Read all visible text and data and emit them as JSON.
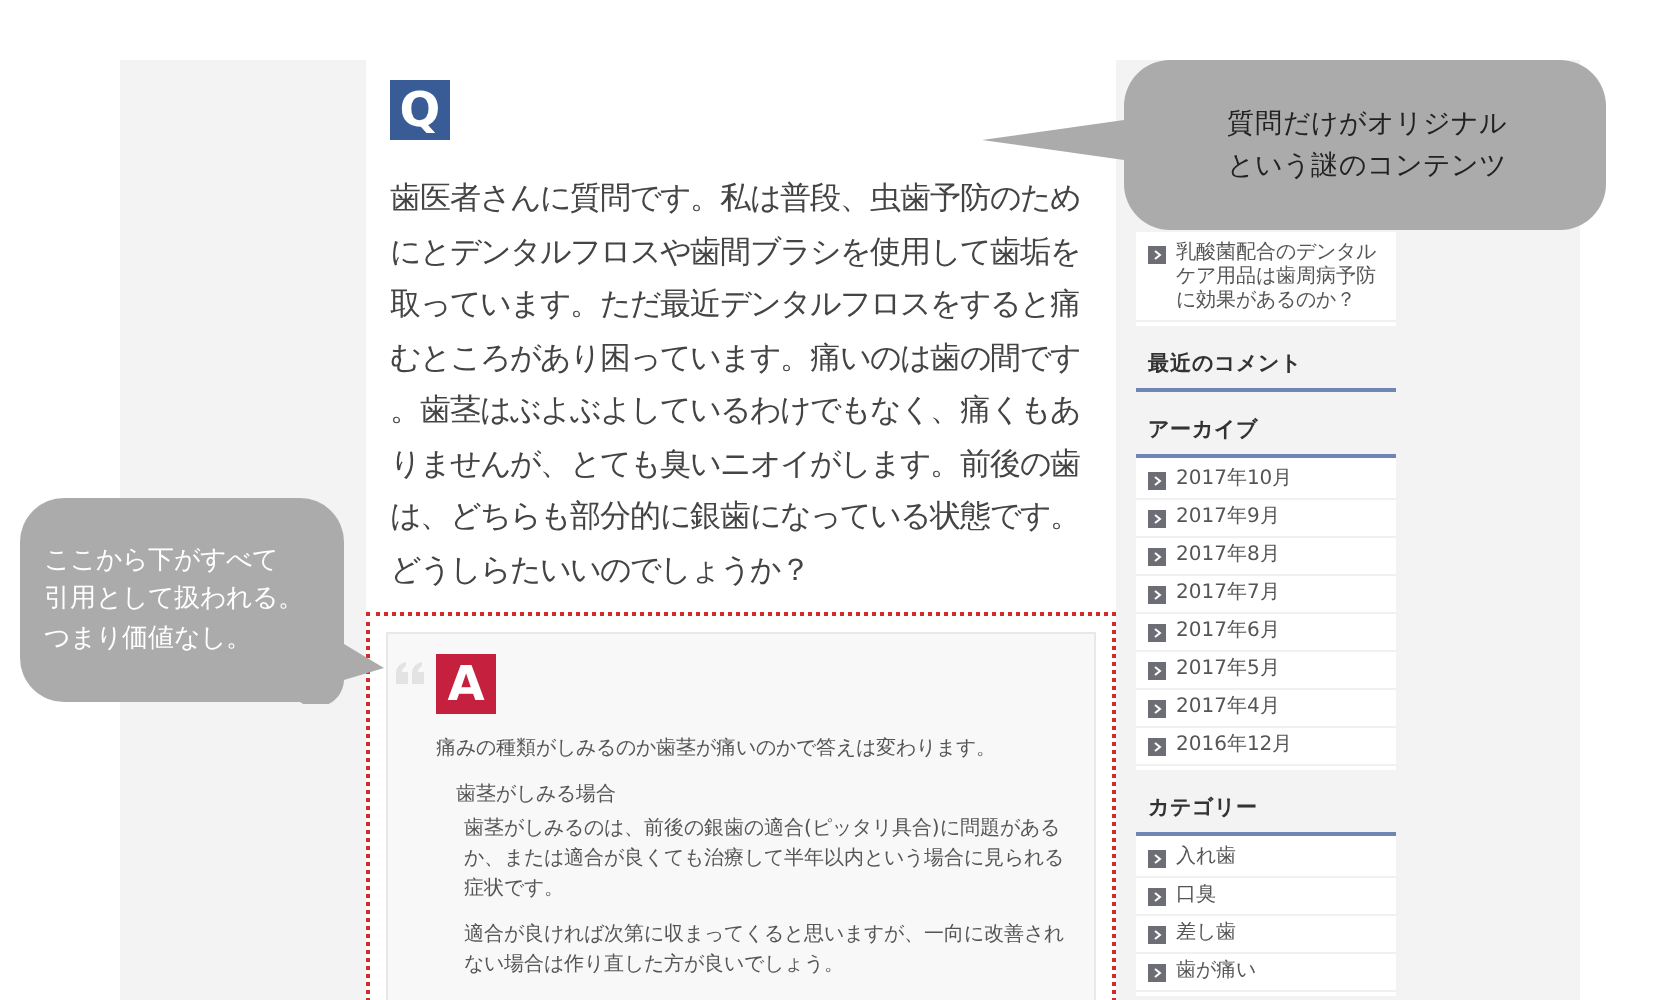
{
  "question": {
    "badge": "Q",
    "text": "歯医者さんに質問です。私は普段、虫歯予防のためにとデンタルフロスや歯間ブラシを使用して歯垢を取っています。ただ最近デンタルフロスをすると痛むところがあり困っています。痛いのは歯の間です。歯茎はぶよぶよしているわけでもなく、痛くもありませんが、とても臭いニオイがします。前後の歯は、どちらも部分的に銀歯になっている状態です。どうしらたいいのでしょうか？"
  },
  "answer": {
    "badge": "A",
    "paragraphs": [
      {
        "kind": "lead",
        "text": "痛みの種類がしみるのか歯茎が痛いのかで答えは変わります。"
      },
      {
        "kind": "heading",
        "text": "歯茎がしみる場合"
      },
      {
        "kind": "body",
        "text": "歯茎がしみるのは、前後の銀歯の適合(ピッタリ具合)に問題があるか、または適合が良くても治療して半年以内という場合に見られる症状です。"
      },
      {
        "kind": "body",
        "text": "適合が良ければ次第に収まってくると思いますが、一向に改善されない場合は作り直した方が良いでしょう。"
      }
    ]
  },
  "sidebar": {
    "recent_posts": [
      {
        "title": "乳酸菌配合のデンタルケア用品は歯周病予防に効果があるのか？"
      }
    ],
    "widgets": [
      {
        "title": "最近のコメント"
      },
      {
        "title": "アーカイブ",
        "items": [
          "2017年10月",
          "2017年9月",
          "2017年8月",
          "2017年7月",
          "2017年6月",
          "2017年5月",
          "2017年4月",
          "2016年12月"
        ]
      },
      {
        "title": "カテゴリー",
        "items": [
          "入れ歯",
          "口臭",
          "差し歯",
          "歯が痛い"
        ]
      }
    ]
  },
  "callouts": [
    {
      "lines": [
        "質問だけがオリジナル",
        "という謎のコンテンツ"
      ]
    },
    {
      "lines": [
        "ここから下がすべて",
        "引用として扱われる。",
        "つまり価値なし。"
      ]
    }
  ]
}
